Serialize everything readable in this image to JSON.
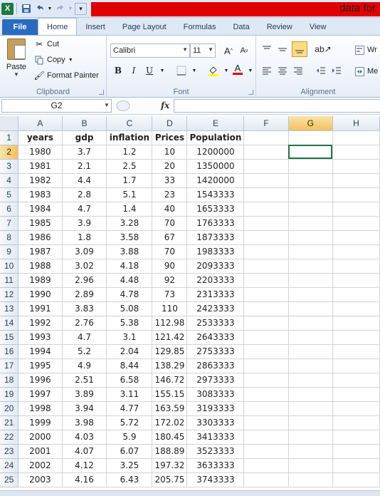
{
  "window": {
    "app_icon_label": "X",
    "title": "data for"
  },
  "tabs": [
    {
      "label": "File"
    },
    {
      "label": "Home"
    },
    {
      "label": "Insert"
    },
    {
      "label": "Page Layout"
    },
    {
      "label": "Formulas"
    },
    {
      "label": "Data"
    },
    {
      "label": "Review"
    },
    {
      "label": "View"
    }
  ],
  "ribbon": {
    "clipboard": {
      "paste_label": "Paste",
      "cut_label": "Cut",
      "copy_label": "Copy",
      "format_painter_label": "Format Painter",
      "group_label": "Clipboard"
    },
    "font": {
      "font_name": "Calibri",
      "font_size": "11",
      "grow_label": "A",
      "shrink_label": "A",
      "bold_label": "B",
      "italic_label": "I",
      "underline_label": "U",
      "font_color_label": "A",
      "group_label": "Font"
    },
    "alignment": {
      "wrap_label": "Wr",
      "merge_label": "Me",
      "group_label": "Alignment"
    }
  },
  "formula_bar": {
    "name_box": "G2",
    "fx_label": "fx",
    "formula": ""
  },
  "grid": {
    "columns": [
      "A",
      "B",
      "C",
      "D",
      "E",
      "F",
      "G",
      "H"
    ],
    "selected_column": "G",
    "selected_row": 2,
    "rows": [
      {
        "n": "1",
        "cells": [
          "years",
          "gdp",
          "inflation",
          "Prices",
          "Population"
        ]
      },
      {
        "n": "2",
        "cells": [
          "1980",
          "3.7",
          "1.2",
          "10",
          "1200000"
        ]
      },
      {
        "n": "3",
        "cells": [
          "1981",
          "2.1",
          "2.5",
          "20",
          "1350000"
        ]
      },
      {
        "n": "4",
        "cells": [
          "1982",
          "4.4",
          "1.7",
          "33",
          "1420000"
        ]
      },
      {
        "n": "5",
        "cells": [
          "1983",
          "2.8",
          "5.1",
          "23",
          "1543333"
        ]
      },
      {
        "n": "6",
        "cells": [
          "1984",
          "4.7",
          "1.4",
          "40",
          "1653333"
        ]
      },
      {
        "n": "7",
        "cells": [
          "1985",
          "3.9",
          "3.28",
          "70",
          "1763333"
        ]
      },
      {
        "n": "8",
        "cells": [
          "1986",
          "1.8",
          "3.58",
          "67",
          "1873333"
        ]
      },
      {
        "n": "9",
        "cells": [
          "1987",
          "3.09",
          "3.88",
          "70",
          "1983333"
        ]
      },
      {
        "n": "10",
        "cells": [
          "1988",
          "3.02",
          "4.18",
          "90",
          "2093333"
        ]
      },
      {
        "n": "11",
        "cells": [
          "1989",
          "2.96",
          "4.48",
          "92",
          "2203333"
        ]
      },
      {
        "n": "12",
        "cells": [
          "1990",
          "2.89",
          "4.78",
          "73",
          "2313333"
        ]
      },
      {
        "n": "13",
        "cells": [
          "1991",
          "3.83",
          "5.08",
          "110",
          "2423333"
        ]
      },
      {
        "n": "14",
        "cells": [
          "1992",
          "2.76",
          "5.38",
          "112.98",
          "2533333"
        ]
      },
      {
        "n": "15",
        "cells": [
          "1993",
          "4.7",
          "3.1",
          "121.42",
          "2643333"
        ]
      },
      {
        "n": "16",
        "cells": [
          "1994",
          "5.2",
          "2.04",
          "129.85",
          "2753333"
        ]
      },
      {
        "n": "17",
        "cells": [
          "1995",
          "4.9",
          "8.44",
          "138.29",
          "2863333"
        ]
      },
      {
        "n": "18",
        "cells": [
          "1996",
          "2.51",
          "6.58",
          "146.72",
          "2973333"
        ]
      },
      {
        "n": "19",
        "cells": [
          "1997",
          "3.89",
          "3.11",
          "155.15",
          "3083333"
        ]
      },
      {
        "n": "20",
        "cells": [
          "1998",
          "3.94",
          "4.77",
          "163.59",
          "3193333"
        ]
      },
      {
        "n": "21",
        "cells": [
          "1999",
          "3.98",
          "5.72",
          "172.02",
          "3303333"
        ]
      },
      {
        "n": "22",
        "cells": [
          "2000",
          "4.03",
          "5.9",
          "180.45",
          "3413333"
        ]
      },
      {
        "n": "23",
        "cells": [
          "2001",
          "4.07",
          "6.07",
          "188.89",
          "3523333"
        ]
      },
      {
        "n": "24",
        "cells": [
          "2002",
          "4.12",
          "3.25",
          "197.32",
          "3633333"
        ]
      },
      {
        "n": "25",
        "cells": [
          "2003",
          "4.16",
          "6.43",
          "205.75",
          "3743333"
        ]
      }
    ]
  }
}
